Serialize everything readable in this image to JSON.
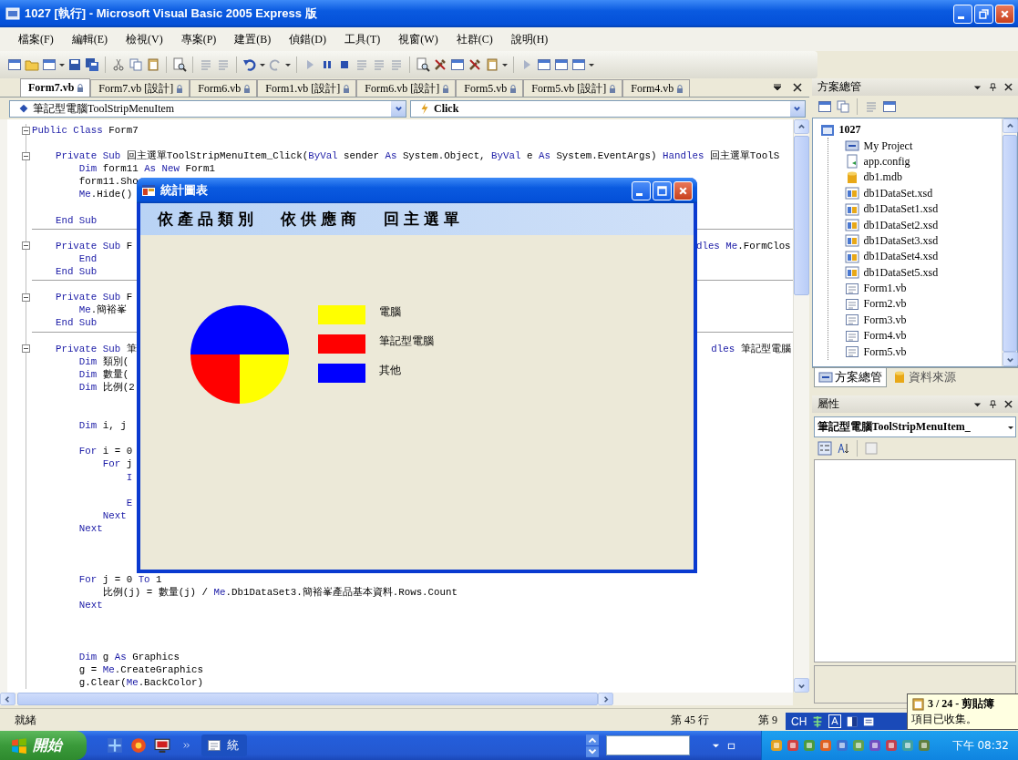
{
  "window": {
    "title": "1027 [執行] - Microsoft Visual Basic 2005 Express 版"
  },
  "menu": [
    "檔案(F)",
    "編輯(E)",
    "檢視(V)",
    "專案(P)",
    "建置(B)",
    "偵錯(D)",
    "工具(T)",
    "視窗(W)",
    "社群(C)",
    "說明(H)"
  ],
  "doc_tabs": [
    {
      "label": "Form7.vb",
      "selected": true
    },
    {
      "label": "Form7.vb [設計]",
      "selected": false
    },
    {
      "label": "Form6.vb",
      "selected": false
    },
    {
      "label": "Form1.vb [設計]",
      "selected": false
    },
    {
      "label": "Form6.vb [設計]",
      "selected": false
    },
    {
      "label": "Form5.vb",
      "selected": false
    },
    {
      "label": "Form5.vb [設計]",
      "selected": false
    },
    {
      "label": "Form4.vb",
      "selected": false
    }
  ],
  "member_bar": {
    "object": "筆記型電腦ToolStripMenuItem",
    "event": "Click"
  },
  "code": [
    {
      "kind": "code",
      "fold": true,
      "tokens": [
        {
          "kind": "keyword",
          "text": "Public Class"
        },
        {
          "kind": "plain",
          "text": " Form7"
        }
      ]
    },
    {
      "kind": "blank"
    },
    {
      "kind": "code",
      "fold": true,
      "tokens": [
        {
          "kind": "keyword",
          "text": "    Private Sub"
        },
        {
          "kind": "plain",
          "text": " 回主選單ToolStripMenuItem_Click("
        },
        {
          "kind": "keyword",
          "text": "ByVal"
        },
        {
          "kind": "plain",
          "text": " sender "
        },
        {
          "kind": "keyword",
          "text": "As"
        },
        {
          "kind": "plain",
          "text": " System.Object, "
        },
        {
          "kind": "keyword",
          "text": "ByVal"
        },
        {
          "kind": "plain",
          "text": " e "
        },
        {
          "kind": "keyword",
          "text": "As"
        },
        {
          "kind": "plain",
          "text": " System.EventArgs) "
        },
        {
          "kind": "keyword",
          "text": "Handles"
        },
        {
          "kind": "plain",
          "text": " 回主選單ToolS"
        }
      ]
    },
    {
      "kind": "code",
      "tokens": [
        {
          "kind": "keyword",
          "text": "        Dim"
        },
        {
          "kind": "plain",
          "text": " form11 "
        },
        {
          "kind": "keyword",
          "text": "As New"
        },
        {
          "kind": "plain",
          "text": " Form1"
        }
      ]
    },
    {
      "kind": "code",
      "tokens": [
        {
          "kind": "plain",
          "text": "        form11.Sho"
        }
      ]
    },
    {
      "kind": "code",
      "tokens": [
        {
          "kind": "keyword",
          "text": "        Me"
        },
        {
          "kind": "plain",
          "text": ".Hide()"
        }
      ]
    },
    {
      "kind": "blank"
    },
    {
      "kind": "code",
      "divider": true,
      "tokens": [
        {
          "kind": "keyword",
          "text": "    End Sub"
        }
      ]
    },
    {
      "kind": "blank"
    },
    {
      "kind": "code",
      "fold": true,
      "tokens": [
        {
          "kind": "keyword",
          "text": "    Private Sub"
        },
        {
          "kind": "plain",
          "text": " F"
        }
      ],
      "tail": [
        {
          "kind": "keyword",
          "text": "dles Me"
        },
        {
          "kind": "plain",
          "text": ".FormClos"
        }
      ]
    },
    {
      "kind": "code",
      "tokens": [
        {
          "kind": "keyword",
          "text": "        End"
        }
      ]
    },
    {
      "kind": "code",
      "divider": true,
      "tokens": [
        {
          "kind": "keyword",
          "text": "    End Sub"
        }
      ]
    },
    {
      "kind": "blank"
    },
    {
      "kind": "code",
      "fold": true,
      "tokens": [
        {
          "kind": "keyword",
          "text": "    Private Sub"
        },
        {
          "kind": "plain",
          "text": " F"
        }
      ]
    },
    {
      "kind": "code",
      "tokens": [
        {
          "kind": "keyword",
          "text": "        Me"
        },
        {
          "kind": "plain",
          "text": ".簡裕峯"
        }
      ]
    },
    {
      "kind": "code",
      "divider": true,
      "tokens": [
        {
          "kind": "keyword",
          "text": "    End Sub"
        }
      ]
    },
    {
      "kind": "blank"
    },
    {
      "kind": "code",
      "fold": true,
      "tokens": [
        {
          "kind": "keyword",
          "text": "    Private Sub"
        },
        {
          "kind": "plain",
          "text": " 筆"
        }
      ],
      "tail": [
        {
          "kind": "keyword",
          "text": "dles"
        },
        {
          "kind": "plain",
          "text": " 筆記型電腦"
        }
      ]
    },
    {
      "kind": "code",
      "tokens": [
        {
          "kind": "keyword",
          "text": "        Dim"
        },
        {
          "kind": "plain",
          "text": " 類別("
        }
      ]
    },
    {
      "kind": "code",
      "tokens": [
        {
          "kind": "keyword",
          "text": "        Dim"
        },
        {
          "kind": "plain",
          "text": " 數量("
        }
      ]
    },
    {
      "kind": "code",
      "tokens": [
        {
          "kind": "keyword",
          "text": "        Dim"
        },
        {
          "kind": "plain",
          "text": " 比例(2"
        }
      ]
    },
    {
      "kind": "blank"
    },
    {
      "kind": "blank"
    },
    {
      "kind": "code",
      "tokens": [
        {
          "kind": "keyword",
          "text": "        Dim"
        },
        {
          "kind": "plain",
          "text": " i, j"
        }
      ]
    },
    {
      "kind": "blank"
    },
    {
      "kind": "code",
      "tokens": [
        {
          "kind": "keyword",
          "text": "        For"
        },
        {
          "kind": "plain",
          "text": " i = 0"
        }
      ]
    },
    {
      "kind": "code",
      "tokens": [
        {
          "kind": "keyword",
          "text": "            For"
        },
        {
          "kind": "plain",
          "text": " j"
        }
      ]
    },
    {
      "kind": "code",
      "tokens": [
        {
          "kind": "keyword",
          "text": "                I"
        }
      ]
    },
    {
      "kind": "blank"
    },
    {
      "kind": "code",
      "tokens": [
        {
          "kind": "keyword",
          "text": "                E"
        }
      ]
    },
    {
      "kind": "code",
      "tokens": [
        {
          "kind": "keyword",
          "text": "            Next"
        }
      ]
    },
    {
      "kind": "code",
      "tokens": [
        {
          "kind": "keyword",
          "text": "        Next"
        }
      ]
    },
    {
      "kind": "blank"
    },
    {
      "kind": "blank"
    },
    {
      "kind": "blank"
    },
    {
      "kind": "code",
      "tokens": [
        {
          "kind": "keyword",
          "text": "        For"
        },
        {
          "kind": "plain",
          "text": " j = 0 "
        },
        {
          "kind": "keyword",
          "text": "To"
        },
        {
          "kind": "plain",
          "text": " 1"
        }
      ]
    },
    {
      "kind": "code",
      "tokens": [
        {
          "kind": "plain",
          "text": "            比例(j) = 數量(j) / "
        },
        {
          "kind": "keyword",
          "text": "Me"
        },
        {
          "kind": "plain",
          "text": ".Db1DataSet3.簡裕峯產品基本資料.Rows.Count"
        }
      ]
    },
    {
      "kind": "code",
      "tokens": [
        {
          "kind": "keyword",
          "text": "        Next"
        }
      ]
    },
    {
      "kind": "blank"
    },
    {
      "kind": "blank"
    },
    {
      "kind": "blank"
    },
    {
      "kind": "code",
      "tokens": [
        {
          "kind": "keyword",
          "text": "        Dim"
        },
        {
          "kind": "plain",
          "text": " g "
        },
        {
          "kind": "keyword",
          "text": "As"
        },
        {
          "kind": "plain",
          "text": " Graphics"
        }
      ]
    },
    {
      "kind": "code",
      "tokens": [
        {
          "kind": "plain",
          "text": "        g = "
        },
        {
          "kind": "keyword",
          "text": "Me"
        },
        {
          "kind": "plain",
          "text": ".CreateGraphics"
        }
      ]
    },
    {
      "kind": "code",
      "tokens": [
        {
          "kind": "plain",
          "text": "        g.Clear("
        },
        {
          "kind": "keyword",
          "text": "Me"
        },
        {
          "kind": "plain",
          "text": ".BackColor)"
        }
      ]
    }
  ],
  "dialog": {
    "title": "統計圖表",
    "menu": [
      "依產品類別",
      "依供應商",
      "回主選單"
    ],
    "legend": [
      {
        "label": "電腦",
        "color": "#ffff00"
      },
      {
        "label": "筆記型電腦",
        "color": "#ff0000"
      },
      {
        "label": "其他",
        "color": "#0000ff"
      }
    ]
  },
  "solution_explorer": {
    "title": "方案總管",
    "tree": [
      {
        "label": "1027",
        "kind": "project",
        "children": [
          {
            "label": "My Project",
            "kind": "settings"
          },
          {
            "label": "app.config",
            "kind": "config"
          },
          {
            "label": "db1.mdb",
            "kind": "database"
          },
          {
            "label": "db1DataSet.xsd",
            "kind": "dataset"
          },
          {
            "label": "db1DataSet1.xsd",
            "kind": "dataset"
          },
          {
            "label": "db1DataSet2.xsd",
            "kind": "dataset"
          },
          {
            "label": "db1DataSet3.xsd",
            "kind": "dataset"
          },
          {
            "label": "db1DataSet4.xsd",
            "kind": "dataset"
          },
          {
            "label": "db1DataSet5.xsd",
            "kind": "dataset"
          },
          {
            "label": "Form1.vb",
            "kind": "form"
          },
          {
            "label": "Form2.vb",
            "kind": "form"
          },
          {
            "label": "Form3.vb",
            "kind": "form"
          },
          {
            "label": "Form4.vb",
            "kind": "form"
          },
          {
            "label": "Form5.vb",
            "kind": "form"
          }
        ]
      }
    ]
  },
  "panel_tabs": [
    {
      "label": "方案總管",
      "selected": true
    },
    {
      "label": "資料來源",
      "selected": false
    }
  ],
  "properties": {
    "title": "屬性",
    "object": "筆記型電腦ToolStripMenuItem_"
  },
  "status_bar": {
    "message": "就緒",
    "line": "第 45 行",
    "column": "第 9"
  },
  "language_bar": {
    "language": "CH",
    "mode": "A"
  },
  "clipboard_balloon": {
    "title": "3 / 24 - 剪貼簿",
    "message": "項目已收集。"
  },
  "taskbar": {
    "start": "開始",
    "task": "統",
    "clock": "下午 08:32"
  }
}
